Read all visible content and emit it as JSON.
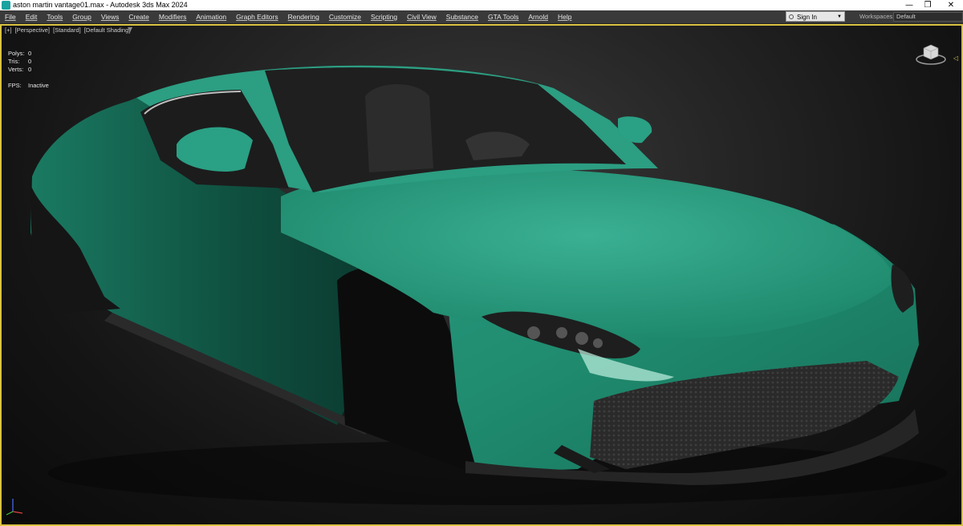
{
  "window": {
    "title": "aston martin vantage01.max - Autodesk 3ds Max 2024",
    "controls": {
      "minimize": "—",
      "restore": "❐",
      "close": "✕"
    }
  },
  "menubar": {
    "items": [
      "File",
      "Edit",
      "Tools",
      "Group",
      "Views",
      "Create",
      "Modifiers",
      "Animation",
      "Graph Editors",
      "Rendering",
      "Customize",
      "Scripting",
      "Civil View",
      "Substance",
      "GTA Tools",
      "Arnold",
      "Help"
    ],
    "signin_label": "Sign In",
    "workspaces_label": "Workspaces:",
    "workspace_value": "Default"
  },
  "viewport": {
    "labels": [
      "[+]",
      "[Perspective]",
      "[Standard]",
      "[Default Shading]"
    ],
    "filter_icon": "funnel-icon",
    "stats": [
      {
        "key": "Polys:",
        "value": "0"
      },
      {
        "key": "Tris:",
        "value": "0"
      },
      {
        "key": "Verts:",
        "value": "0"
      }
    ],
    "fps": {
      "key": "FPS:",
      "value": "Inactive"
    },
    "active_border_color": "#d9c241",
    "car_body_color": "#1f8f73"
  }
}
